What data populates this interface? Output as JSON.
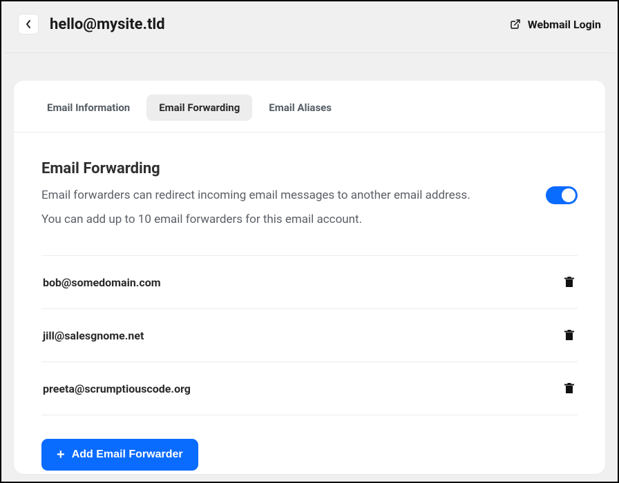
{
  "header": {
    "title": "hello@mysite.tld",
    "webmail_label": "Webmail Login"
  },
  "tabs": [
    {
      "label": "Email Information",
      "active": false
    },
    {
      "label": "Email Forwarding",
      "active": true
    },
    {
      "label": "Email Aliases",
      "active": false
    }
  ],
  "section": {
    "title": "Email Forwarding",
    "desc1": "Email forwarders can redirect incoming email messages to another email address.",
    "desc2": "You can add up to 10 email forwarders for this email account.",
    "toggle_on": true
  },
  "forwarders": [
    {
      "email": "bob@somedomain.com"
    },
    {
      "email": "jill@salesgnome.net"
    },
    {
      "email": "preeta@scrumptiouscode.org"
    }
  ],
  "add_button_label": "Add Email Forwarder"
}
